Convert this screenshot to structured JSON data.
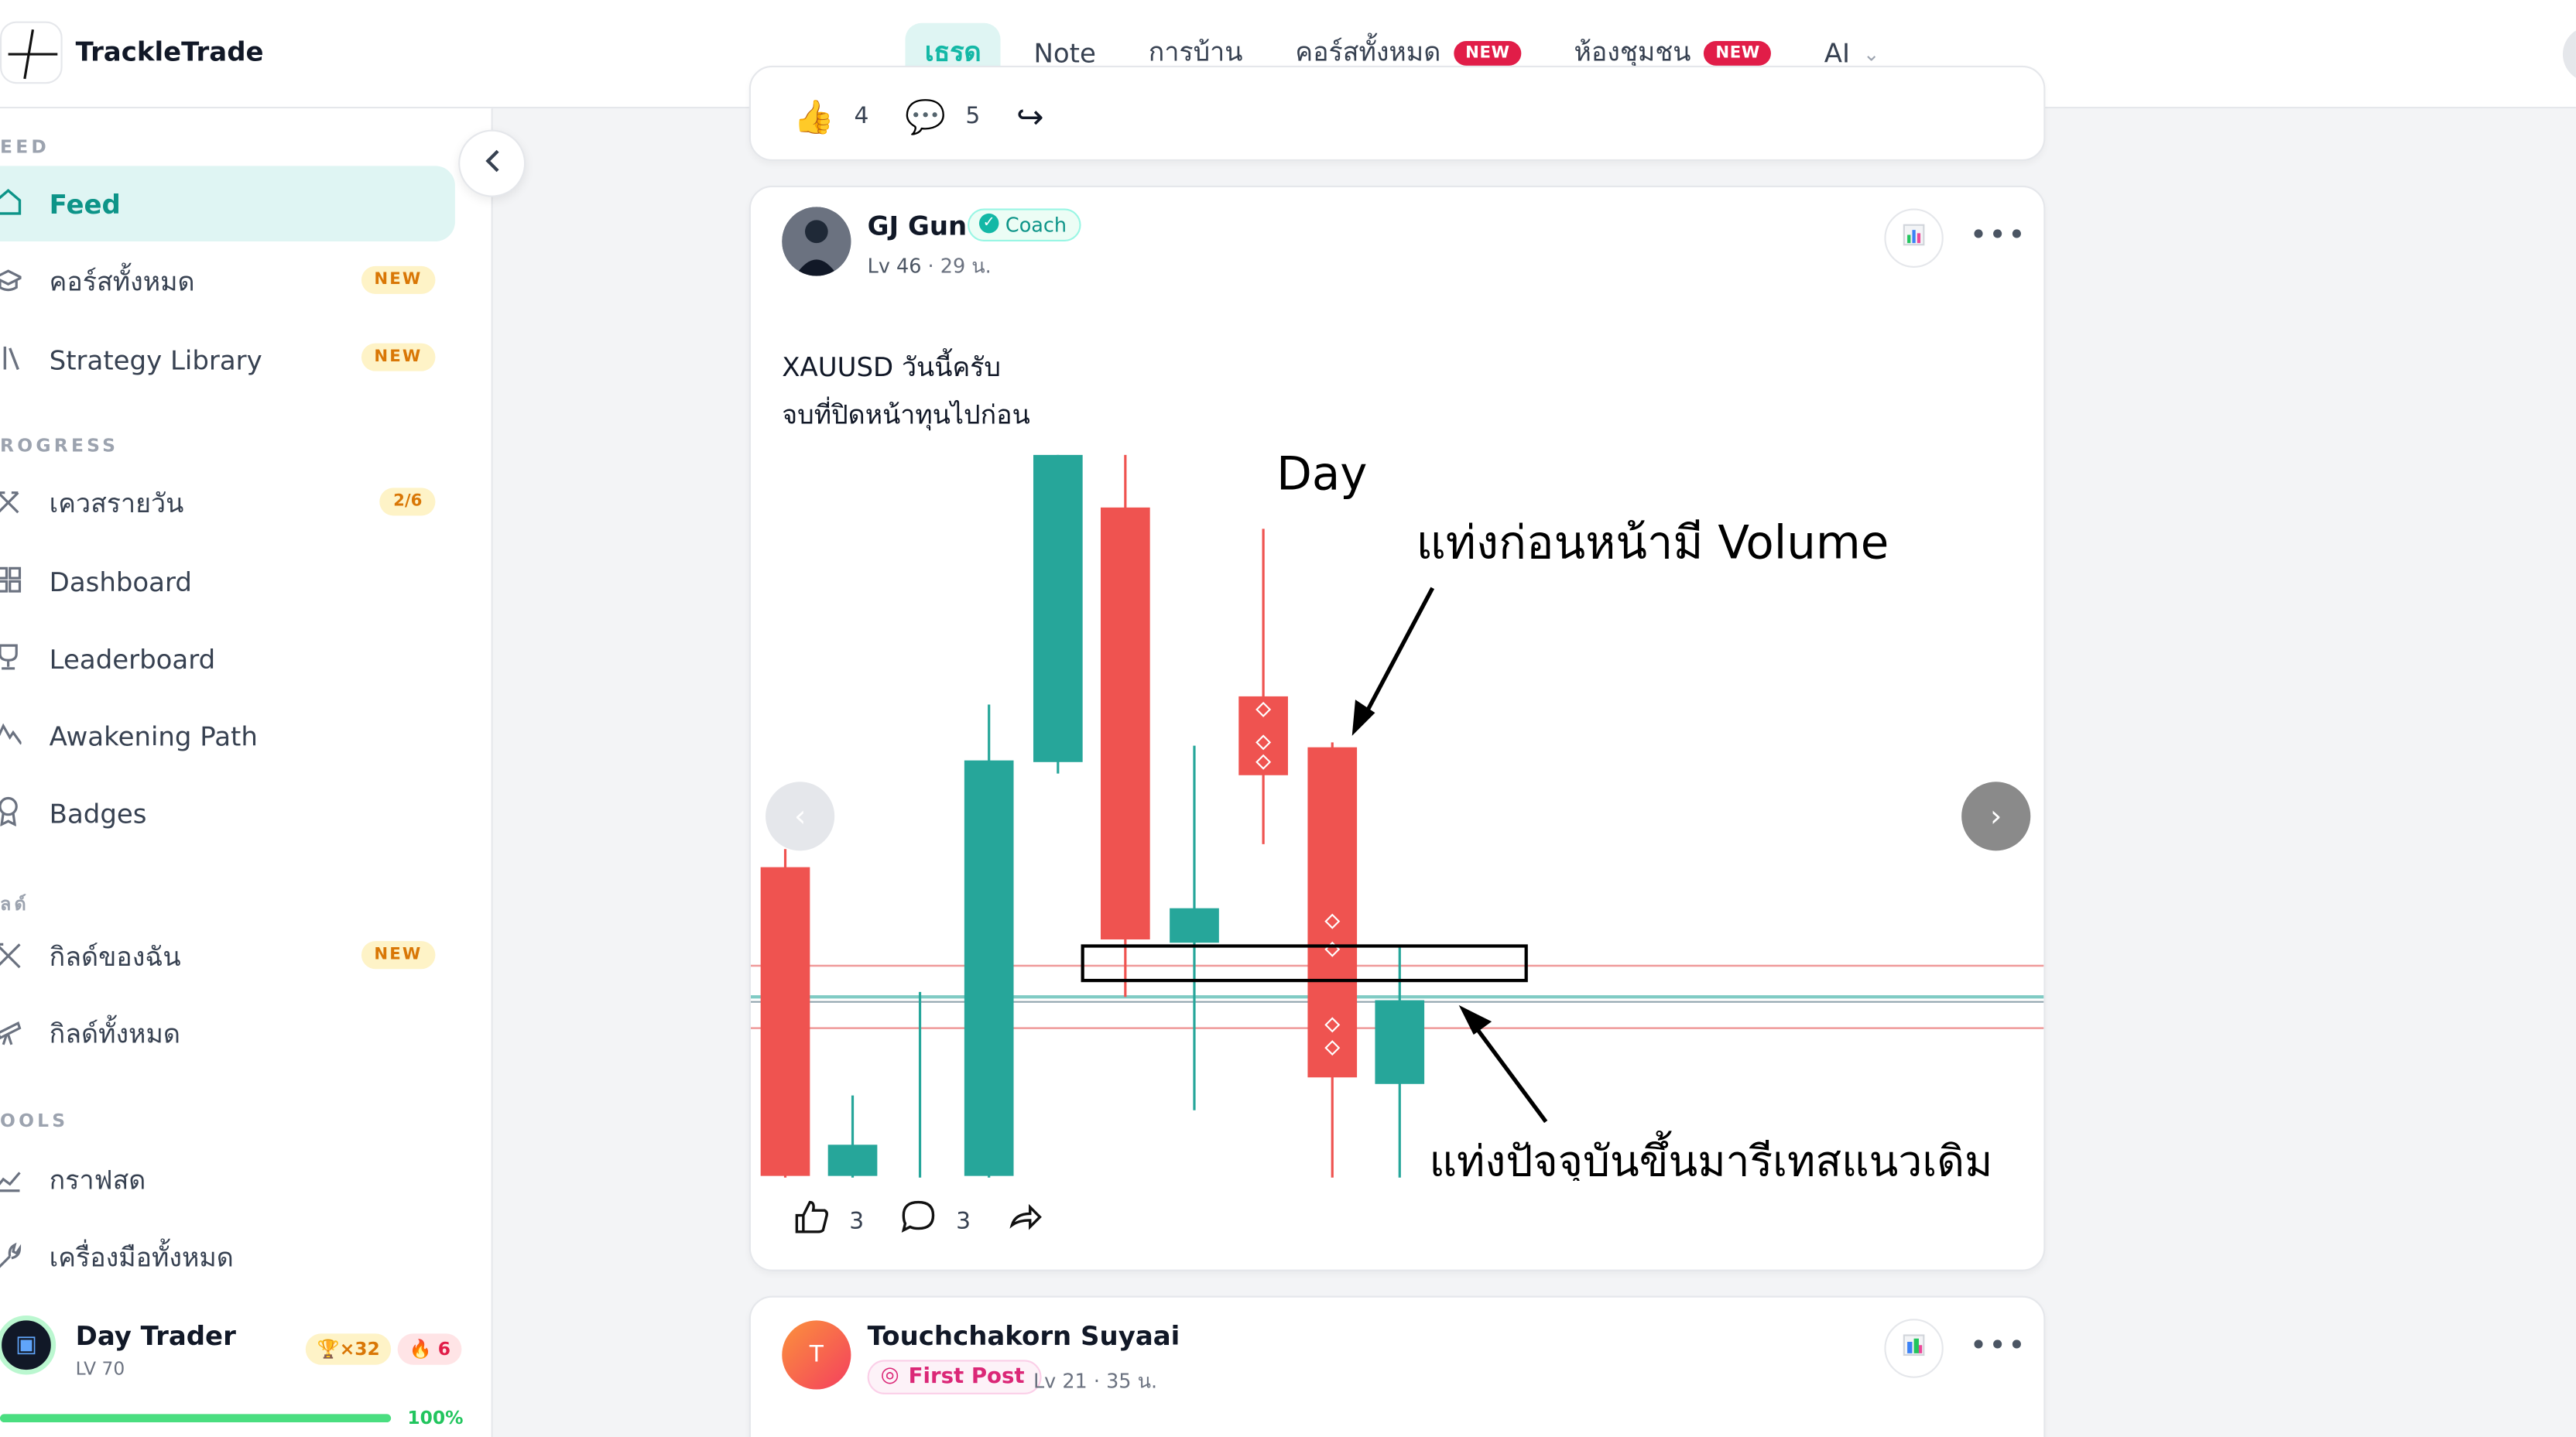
{
  "app": {
    "name": "TrackleTrade"
  },
  "nav": {
    "items": [
      {
        "label": "เธรด",
        "active": true
      },
      {
        "label": "Note"
      },
      {
        "label": "การบ้าน"
      },
      {
        "label": "คอร์สทั้งหมด",
        "badge": "NEW"
      },
      {
        "label": "ห้องชุมชน",
        "badge": "NEW"
      },
      {
        "label": "AI"
      }
    ]
  },
  "sidebar": {
    "sections": {
      "feed": "EED",
      "progress": "ROGRESS",
      "skills": "ลด์",
      "tools": "OOLS"
    },
    "items": [
      {
        "label": "Feed",
        "icon": "home-icon"
      },
      {
        "label": "คอร์สทั้งหมด",
        "badge": "NEW",
        "icon": "graduation-cap-icon"
      },
      {
        "label": "Strategy Library",
        "badge": "NEW",
        "icon": "library-icon"
      },
      {
        "label": "เควสรายวัน",
        "badge": "2/6",
        "icon": "quest-icon"
      },
      {
        "label": "Dashboard",
        "icon": "dashboard-icon"
      },
      {
        "label": "Leaderboard",
        "icon": "trophy-icon"
      },
      {
        "label": "Awakening Path",
        "icon": "mountain-icon"
      },
      {
        "label": "Badges",
        "icon": "badge-icon"
      },
      {
        "label": "กิลด์ของฉัน",
        "badge": "NEW",
        "icon": "swords-icon"
      },
      {
        "label": "กิลด์ทั้งหมด",
        "icon": "telescope-icon"
      },
      {
        "label": "กราฟสด",
        "icon": "chart-line-icon"
      },
      {
        "label": "เครื่องมือทั้งหมด",
        "icon": "wrench-icon"
      }
    ],
    "user": {
      "name": "Day Trader",
      "level": "LV 70",
      "trophies": "×32",
      "streak": "6",
      "progress_label": "100%",
      "progress": 1.0
    }
  },
  "posts": [
    {
      "likes": "4",
      "comments": "5"
    },
    {
      "author": "GJ Gun",
      "role": "Coach",
      "level": "Lv 46",
      "time": "29 น.",
      "text_line1": "XAUUSD วันนี้ครับ",
      "text_line2": "จบที่ปิดหน้าทุนไปก่อน",
      "image": {
        "title": "Day",
        "annotation_top": "แท่งก่อนหน้ามี Volume",
        "annotation_bottom": "แท่งปัจจุบันขึ้นมารีเทสแนวเดิม"
      },
      "likes": "3",
      "comments": "3"
    },
    {
      "author": "Touchchakorn Suyaai",
      "avatar_letter": "T",
      "tag": "First Post",
      "level": "Lv 21",
      "time": "35 น."
    }
  ],
  "colors": {
    "accent": "#14b8a6",
    "bear": "#ef5350",
    "bull": "#26a69a",
    "new_red": "#e11d48"
  }
}
